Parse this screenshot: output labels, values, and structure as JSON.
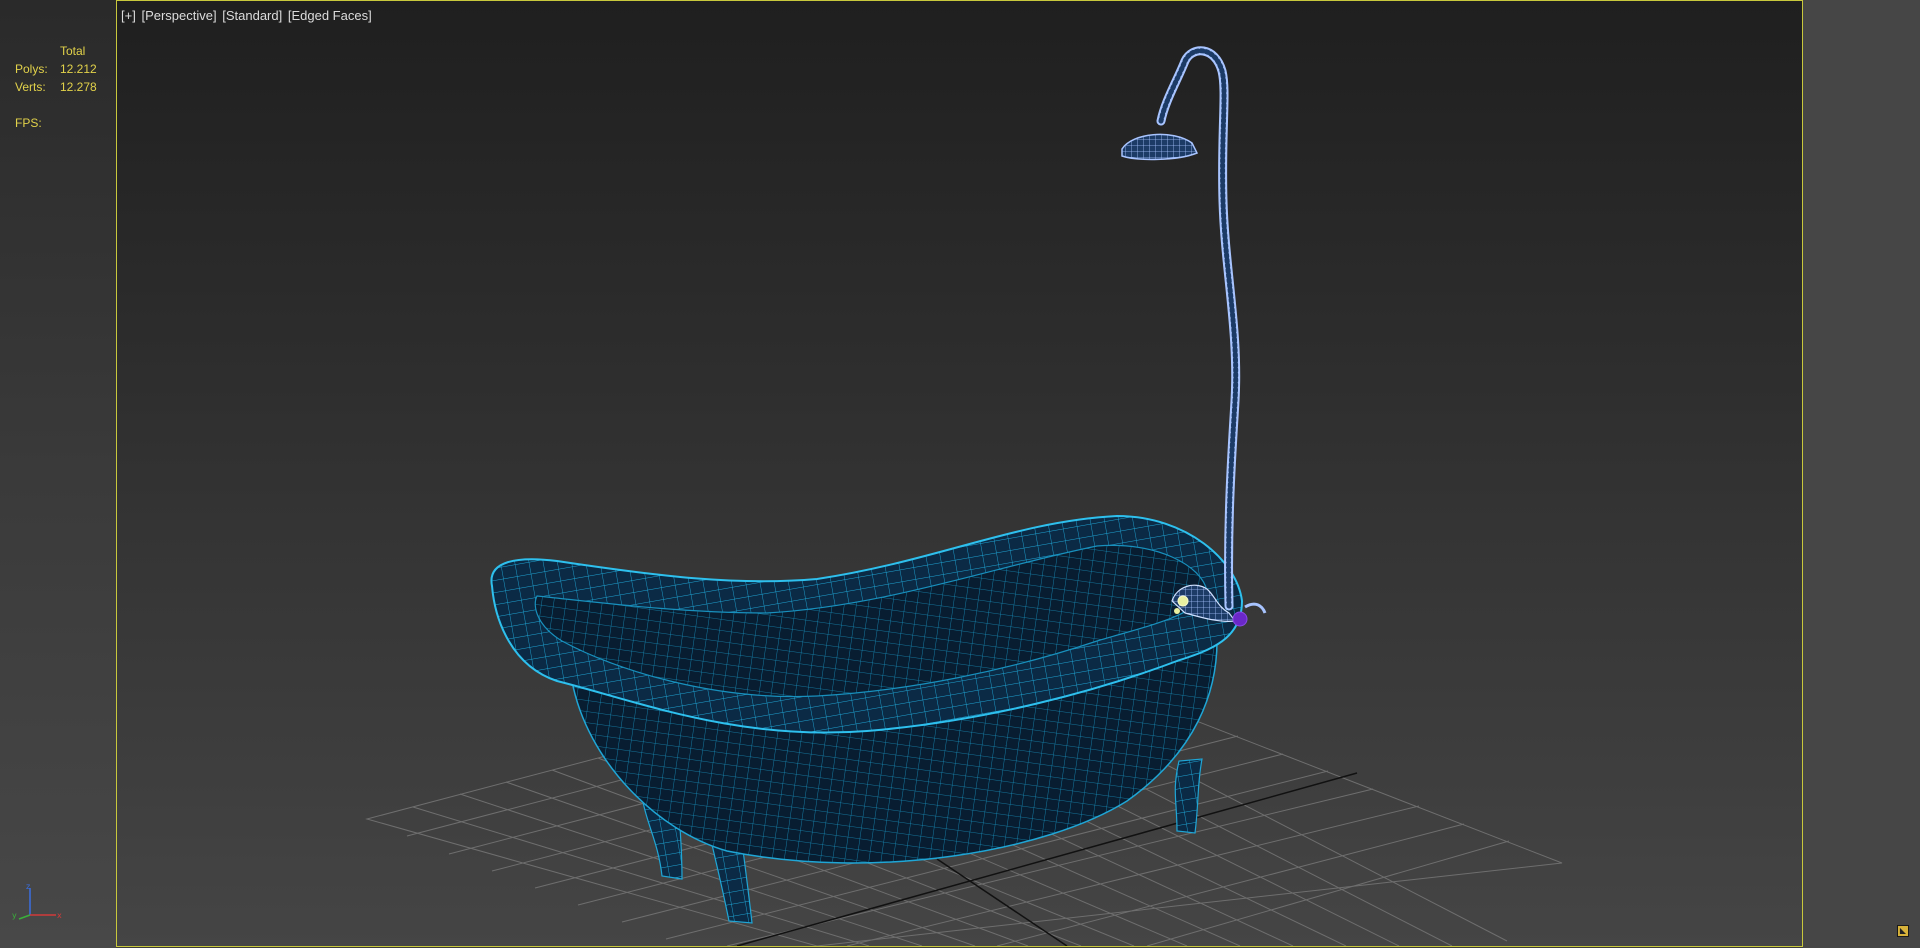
{
  "viewport": {
    "labels": [
      "[+]",
      "[Perspective]",
      "[Standard]",
      "[Edged Faces]"
    ]
  },
  "stats": {
    "header": "Total",
    "polys_label": "Polys:",
    "polys_value": "12.212",
    "verts_label": "Verts:",
    "verts_value": "12.278",
    "fps_label": "FPS:"
  },
  "gizmo": {
    "x_label": "x",
    "y_label": "y",
    "z_label": "z"
  },
  "colors": {
    "viewport_border": "#c8c83c",
    "stats_text": "#e2d24a",
    "wire": "#1fa6d6",
    "mesh_fill": "#0b2a45",
    "grid": "#707070"
  },
  "icons": {
    "corner": "maximize-toggle-icon"
  }
}
